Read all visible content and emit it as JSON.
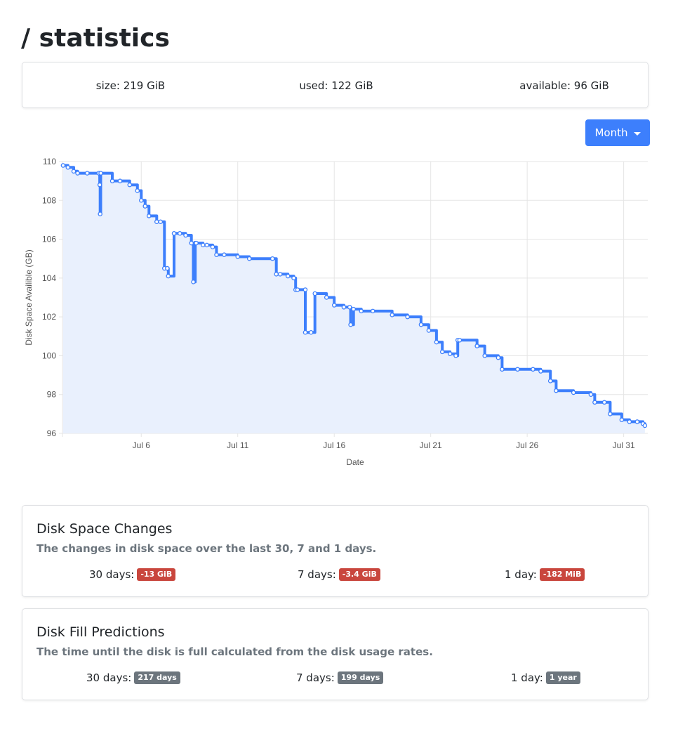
{
  "page": {
    "title": "/ statistics"
  },
  "stats": {
    "size": "size: 219 GiB",
    "used": "used: 122 GiB",
    "available": "available: 96 GiB"
  },
  "range_dropdown": {
    "label": "Month"
  },
  "colors": {
    "line": "#3d7ffc",
    "fill": "#e9f0fd",
    "danger": "#c9463d",
    "secondary": "#6c757d",
    "grid": "#e5e5e5"
  },
  "chart_data": {
    "type": "line",
    "xlabel": "Date",
    "ylabel": "Disk Space Availible (GB)",
    "ylim": [
      96,
      110
    ],
    "xlim": [
      "Jul 1 22:00",
      "Aug 1 06:00"
    ],
    "yticks": [
      110,
      108,
      106,
      104,
      102,
      100,
      98,
      96
    ],
    "xticks": [
      {
        "label": "Jul 6",
        "day": 6
      },
      {
        "label": "Jul 11",
        "day": 11
      },
      {
        "label": "Jul 16",
        "day": 16
      },
      {
        "label": "Jul 21",
        "day": 21
      },
      {
        "label": "Jul 26",
        "day": 26
      },
      {
        "label": "Jul 31",
        "day": 31
      }
    ],
    "grid": true,
    "series": [
      {
        "x": [
          1.95,
          2.2,
          2.5,
          2.7,
          3.2,
          3.8,
          3.85,
          3.87,
          3.9,
          4.5,
          4.9,
          5.4,
          5.8,
          6.0,
          6.2,
          6.4,
          6.8,
          7.0,
          7.2,
          7.35,
          7.4,
          7.7,
          8.0,
          8.3,
          8.6,
          8.7,
          8.8,
          8.85,
          9.2,
          9.4,
          9.7,
          9.9,
          10.3,
          11.0,
          11.6,
          12.8,
          13.0,
          13.2,
          13.6,
          13.9,
          14.0,
          14.1,
          14.5,
          14.5,
          14.8,
          15.0,
          15.6,
          16.0,
          16.5,
          16.8,
          16.85,
          17.0,
          17.4,
          18.0,
          19.0,
          19.8,
          20.5,
          20.9,
          21.3,
          21.6,
          22.0,
          22.3,
          22.4,
          22.5,
          23.4,
          23.8,
          24.5,
          24.7,
          25.5,
          26.3,
          26.7,
          27.2,
          27.5,
          28.4,
          29.3,
          29.5,
          30.0,
          30.3,
          30.9,
          31.3,
          31.7,
          32.0,
          32.1
        ],
        "y": [
          109.8,
          109.7,
          109.5,
          109.4,
          109.4,
          109.4,
          108.8,
          107.3,
          109.4,
          109.0,
          109.0,
          108.8,
          108.5,
          108.0,
          107.7,
          107.2,
          106.9,
          106.9,
          104.5,
          104.5,
          104.1,
          106.3,
          106.3,
          106.2,
          105.8,
          103.8,
          105.8,
          105.8,
          105.7,
          105.7,
          105.6,
          105.2,
          105.2,
          105.1,
          105.0,
          105.0,
          104.2,
          104.2,
          104.1,
          104.0,
          103.4,
          103.4,
          103.4,
          101.2,
          101.2,
          103.2,
          103.0,
          102.6,
          102.5,
          102.5,
          101.6,
          102.4,
          102.3,
          102.3,
          102.1,
          102.0,
          101.6,
          101.3,
          100.7,
          100.2,
          100.1,
          100.0,
          100.8,
          100.8,
          100.5,
          100.0,
          99.9,
          99.3,
          99.3,
          99.3,
          99.2,
          98.7,
          98.2,
          98.1,
          98.0,
          97.6,
          97.6,
          97.0,
          96.7,
          96.6,
          96.6,
          96.5,
          96.4
        ]
      }
    ]
  },
  "changes_card": {
    "title": "Disk Space Changes",
    "subtitle": "The changes in disk space over the last 30, 7 and 1 days.",
    "items": [
      {
        "label": "30 days:",
        "badge": "-13 GiB"
      },
      {
        "label": "7 days:",
        "badge": "-3.4 GiB"
      },
      {
        "label": "1 day:",
        "badge": "-182 MiB"
      }
    ]
  },
  "predictions_card": {
    "title": "Disk Fill Predictions",
    "subtitle": "The time until the disk is full calculated from the disk usage rates.",
    "items": [
      {
        "label": "30 days:",
        "badge": "217 days"
      },
      {
        "label": "7 days:",
        "badge": "199 days"
      },
      {
        "label": "1 day:",
        "badge": "1 year"
      }
    ]
  }
}
